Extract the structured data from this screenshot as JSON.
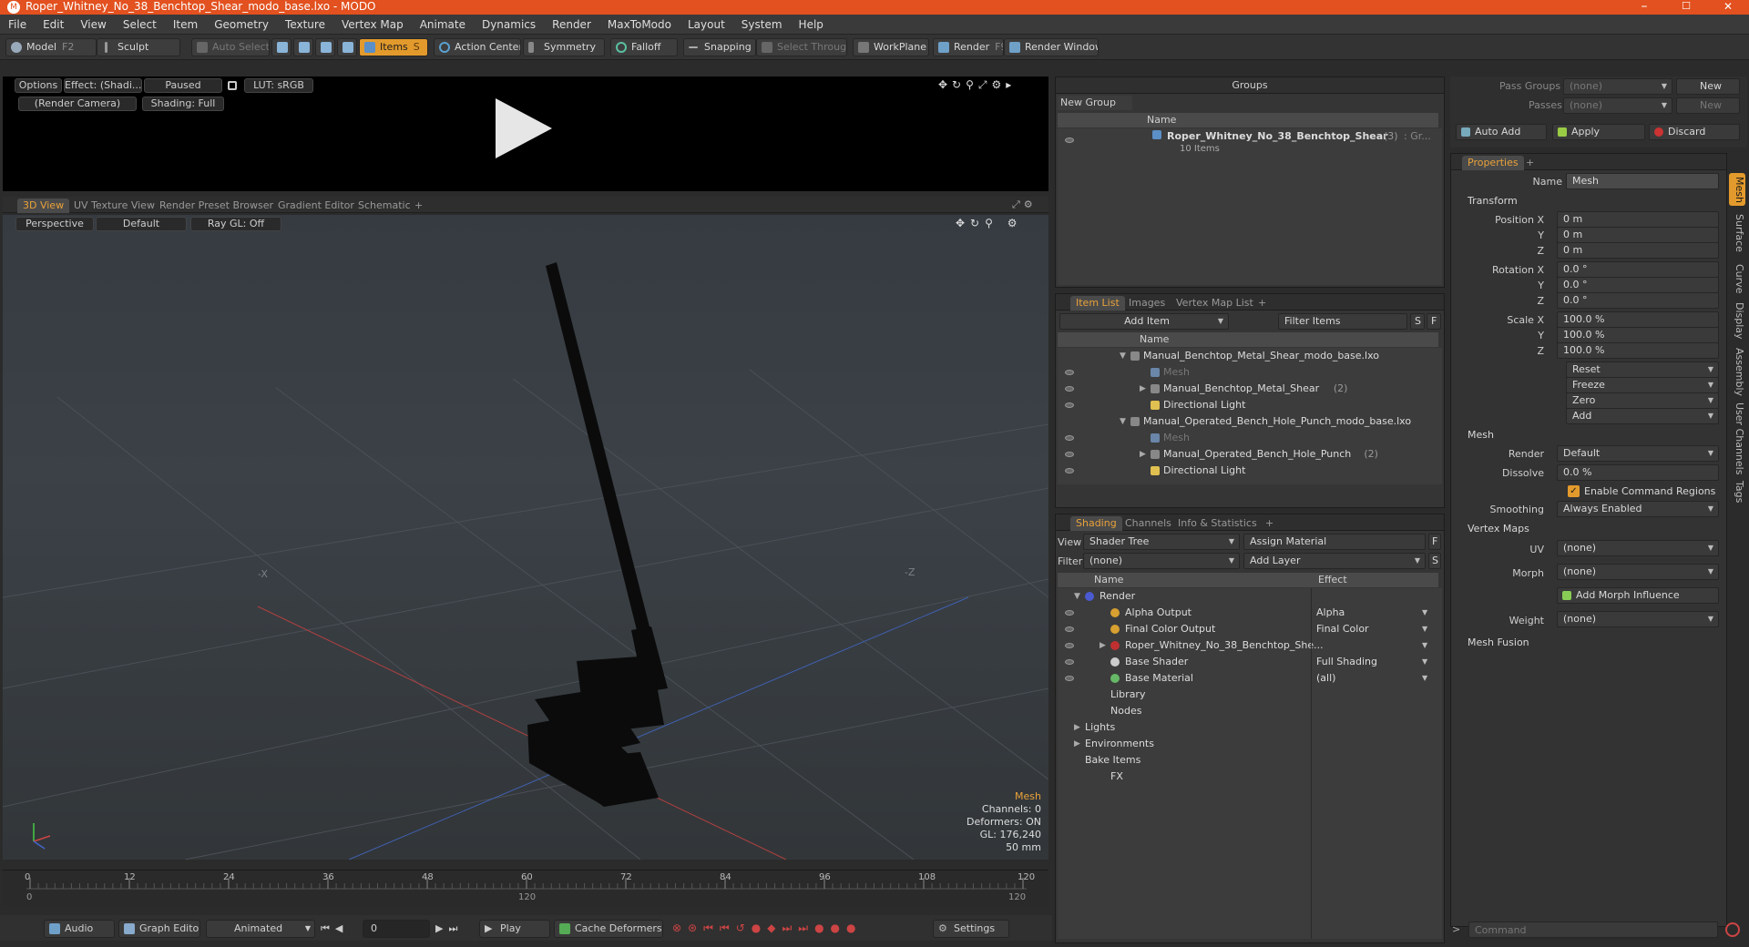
{
  "window": {
    "title": "Roper_Whitney_No_38_Benchtop_Shear_modo_base.lxo - MODO",
    "logo": "M",
    "minimize": "–",
    "maximize": "☐",
    "close": "✕"
  },
  "menu": [
    "File",
    "Edit",
    "View",
    "Select",
    "Item",
    "Geometry",
    "Texture",
    "Vertex Map",
    "Animate",
    "Dynamics",
    "Render",
    "MaxToModo",
    "Layout",
    "System",
    "Help"
  ],
  "toolbar": {
    "model": "Model",
    "model_key": "F2",
    "sculpt": "Sculpt",
    "auto_select": "Auto Select",
    "items": "Items",
    "items_key": "S",
    "action_center": "Action Center",
    "symmetry": "Symmetry",
    "falloff": "Falloff",
    "snapping": "Snapping",
    "select_through": "Select Through",
    "workplane": "WorkPlane",
    "render": "Render",
    "render_key": "F9",
    "render_window": "Render Window"
  },
  "preview": {
    "options": "Options",
    "effect": "Effect: (Shadi...",
    "paused": "Paused",
    "lut": "LUT: sRGB",
    "camera": "(Render Camera)",
    "shading": "Shading: Full"
  },
  "view_tabs": [
    "3D View",
    "UV Texture View",
    "Render Preset Browser",
    "Gradient Editor",
    "Schematic",
    "+"
  ],
  "viewport": {
    "perspective": "Perspective",
    "default": "Default",
    "raygl": "Ray GL: Off",
    "axis_x": "-X",
    "axis_z": "-Z",
    "info": {
      "mesh": "Mesh",
      "channels": "Channels: 0",
      "deformers": "Deformers: ON",
      "gl": "GL: 176,240",
      "size": "50 mm"
    }
  },
  "timeline": {
    "ticks": [
      "0",
      "12",
      "24",
      "36",
      "48",
      "60",
      "72",
      "84",
      "96",
      "108",
      "120"
    ],
    "start": "0",
    "mid": "120",
    "end": "120"
  },
  "bottombar": {
    "audio": "Audio",
    "graph_editor": "Graph Editor",
    "animated": "Animated",
    "frame": "0",
    "play": "Play",
    "cache_deformers": "Cache Deformers",
    "settings": "Settings"
  },
  "groups": {
    "title": "Groups",
    "new_group": "New Group",
    "col_name": "Name",
    "item_name": "Roper_Whitney_No_38_Benchtop_Shear",
    "item_count": "(3)",
    "item_suffix": ": Gr...",
    "item_sub": "10 Items"
  },
  "itemlist": {
    "tabs": [
      "Item List",
      "Images",
      "Vertex Map List",
      "+"
    ],
    "add_item": "Add Item",
    "filter": "Filter Items",
    "s": "S",
    "f": "F",
    "col_name": "Name",
    "rows": [
      {
        "text": "Manual_Benchtop_Metal_Shear_modo_base.lxo",
        "tri": "▼"
      },
      {
        "text": "Mesh",
        "tri": ""
      },
      {
        "text": "Manual_Benchtop_Metal_Shear",
        "count": "(2)",
        "tri": "▶"
      },
      {
        "text": "Directional Light",
        "tri": ""
      },
      {
        "text": "Manual_Operated_Bench_Hole_Punch_modo_base.lxo",
        "tri": "▼"
      },
      {
        "text": "Mesh",
        "tri": ""
      },
      {
        "text": "Manual_Operated_Bench_Hole_Punch",
        "count": "(2)",
        "tri": "▶"
      },
      {
        "text": "Directional Light",
        "tri": ""
      }
    ]
  },
  "shading": {
    "tabs": [
      "Shading",
      "Channels",
      "Info & Statistics",
      "+"
    ],
    "view_label": "View",
    "view_value": "Shader Tree",
    "assign": "Assign Material",
    "f": "F",
    "filter_label": "Filter",
    "filter_value": "(none)",
    "add_layer": "Add Layer",
    "s": "S",
    "col_name": "Name",
    "col_effect": "Effect",
    "rows": [
      {
        "name": "Render",
        "effect": "",
        "tri": "▼"
      },
      {
        "name": "Alpha Output",
        "effect": "Alpha",
        "tri": ""
      },
      {
        "name": "Final Color Output",
        "effect": "Final Color",
        "tri": ""
      },
      {
        "name": "Roper_Whitney_No_38_Benchtop_She...",
        "effect": "",
        "tri": "▶"
      },
      {
        "name": "Base Shader",
        "effect": "Full Shading",
        "tri": ""
      },
      {
        "name": "Base Material",
        "effect": "(all)",
        "tri": ""
      },
      {
        "name": "Library",
        "effect": "",
        "tri": ""
      },
      {
        "name": "Nodes",
        "effect": "",
        "tri": ""
      },
      {
        "name": "Lights",
        "effect": "",
        "tri": "▶"
      },
      {
        "name": "Environments",
        "effect": "",
        "tri": "▶"
      },
      {
        "name": "Bake Items",
        "effect": "",
        "tri": ""
      },
      {
        "name": "FX",
        "effect": "",
        "tri": ""
      }
    ]
  },
  "passes": {
    "pass_groups": "Pass Groups",
    "pass_groups_value": "(none)",
    "new": "New",
    "passes": "Passes",
    "passes_value": "(none)",
    "new2": "New",
    "auto_add": "Auto Add",
    "apply": "Apply",
    "discard": "Discard"
  },
  "properties": {
    "tab": "Properties",
    "plus": "+",
    "name_label": "Name",
    "name_value": "Mesh",
    "transform": "Transform",
    "position_x": "Position X",
    "y": "Y",
    "z": "Z",
    "pos": [
      "0 m",
      "0 m",
      "0 m"
    ],
    "rotation_x": "Rotation X",
    "rot": [
      "0.0 °",
      "0.0 °",
      "0.0 °"
    ],
    "scale_x": "Scale X",
    "scale": [
      "100.0 %",
      "100.0 %",
      "100.0 %"
    ],
    "reset": "Reset",
    "freeze": "Freeze",
    "zero": "Zero",
    "add": "Add",
    "mesh": "Mesh",
    "render_label": "Render",
    "render_value": "Default",
    "dissolve_label": "Dissolve",
    "dissolve_value": "0.0 %",
    "enable_cmd": "Enable Command Regions",
    "smoothing_label": "Smoothing",
    "smoothing_value": "Always Enabled",
    "vertex_maps": "Vertex Maps",
    "uv_label": "UV",
    "uv_value": "(none)",
    "morph_label": "Morph",
    "morph_value": "(none)",
    "add_morph": "Add Morph Influence",
    "weight_label": "Weight",
    "weight_value": "(none)",
    "mesh_fusion": "Mesh Fusion"
  },
  "sidetabs": [
    "Mesh",
    "Surface",
    "Curve",
    "Display",
    "Assembly",
    "User Channels",
    "Tags"
  ],
  "command": {
    "placeholder": "Command"
  },
  "colors": {
    "accent": "#e39a2c",
    "titlebar": "#e2511f"
  }
}
